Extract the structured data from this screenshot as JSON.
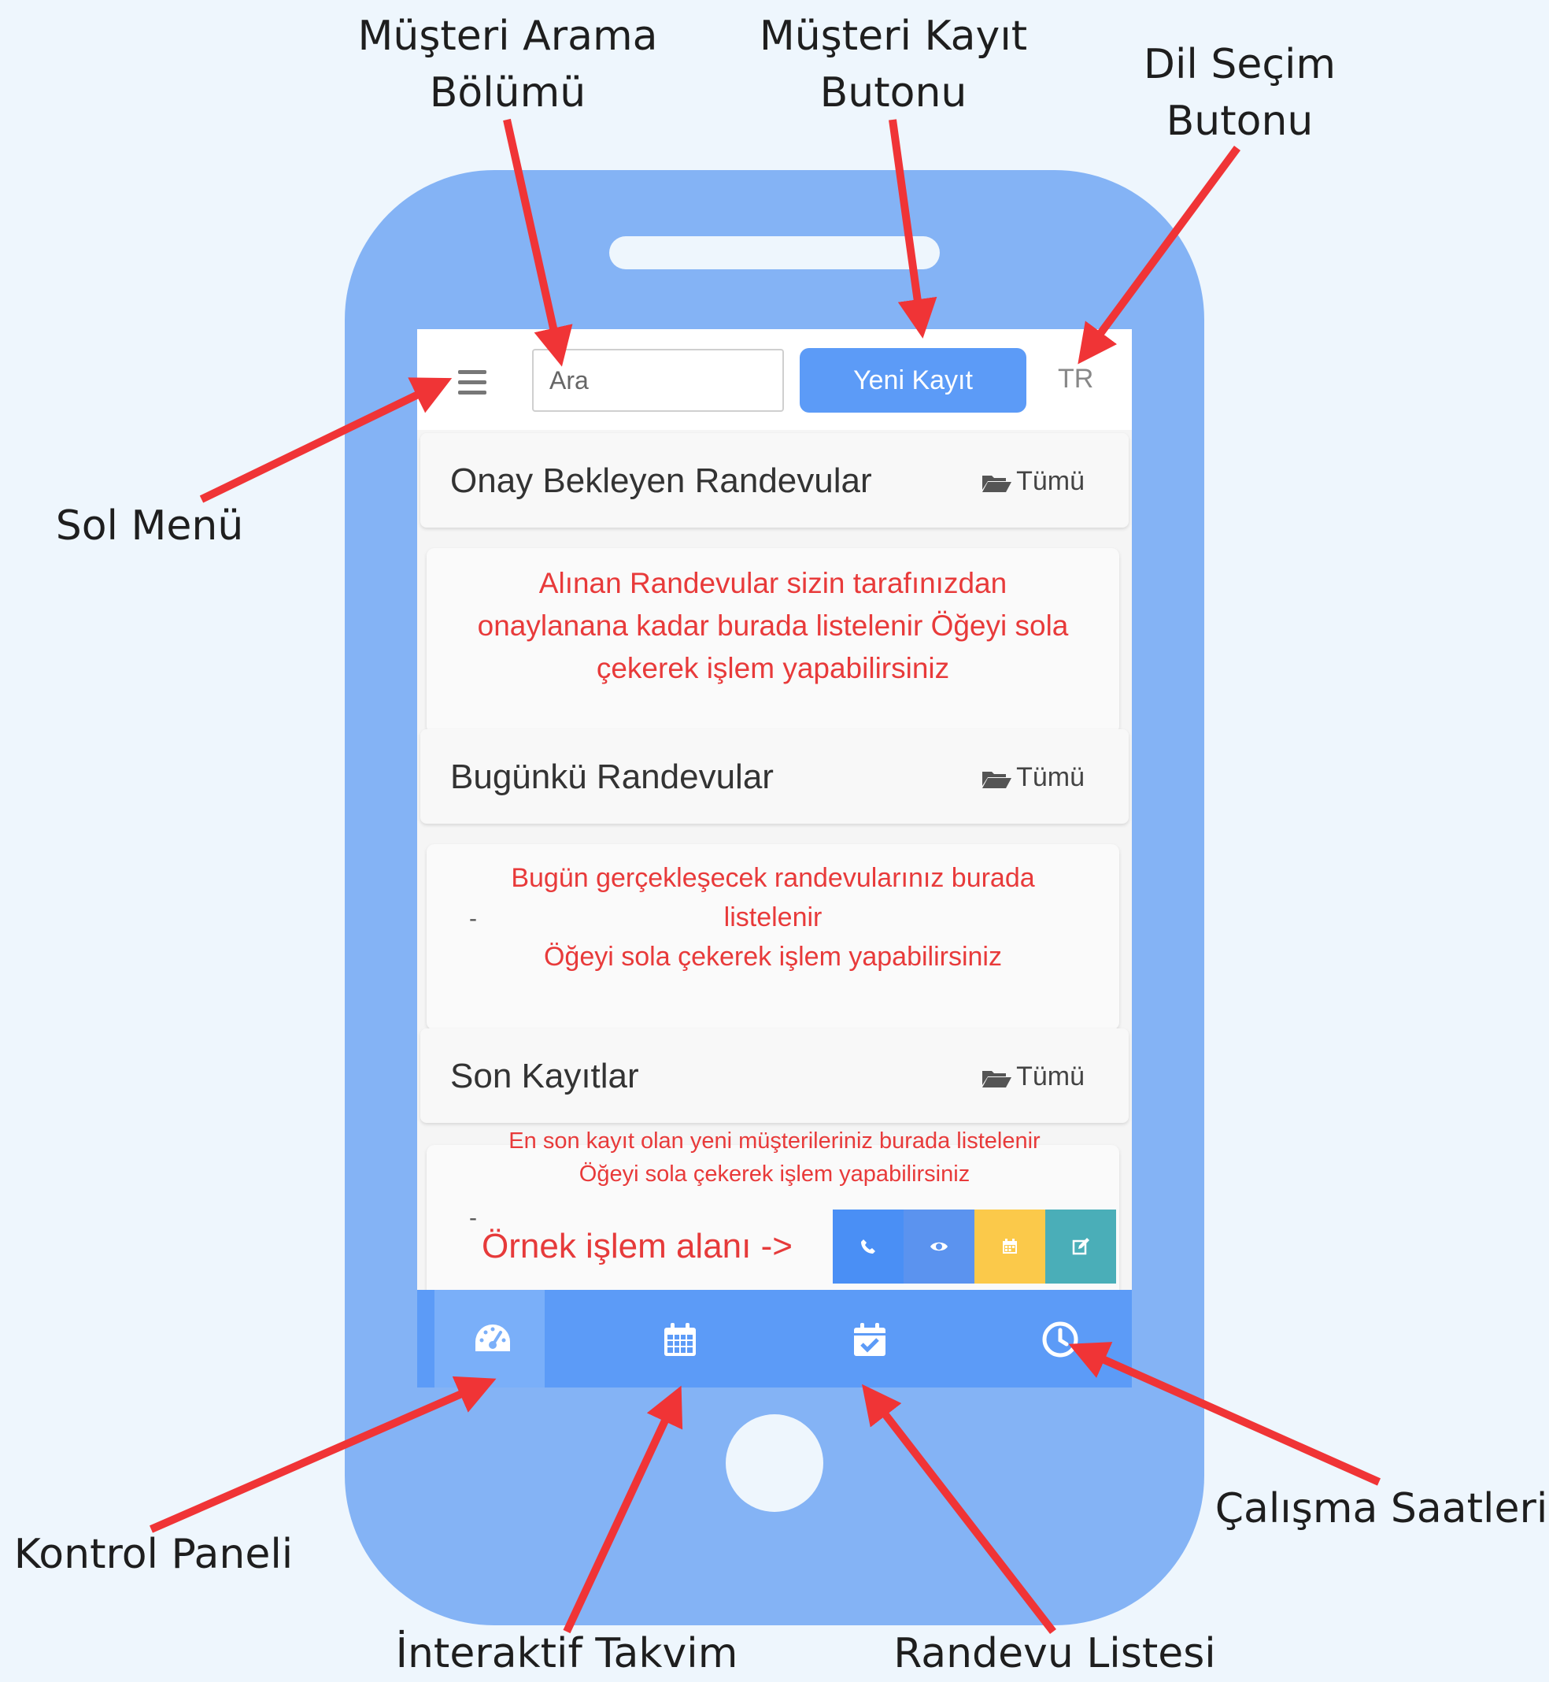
{
  "callouts": {
    "musteri_arama": [
      "Müşteri Arama",
      "Bölümü"
    ],
    "musteri_kayit": [
      "Müşteri Kayıt",
      "Butonu"
    ],
    "dil_secim": [
      "Dil Seçim",
      "Butonu"
    ],
    "sol_menu": "Sol Menü",
    "kontrol_paneli": "Kontrol Paneli",
    "interaktif_takvim": "İnteraktif Takvim",
    "randevu_listesi": "Randevu Listesi",
    "calisma_saatleri": "Çalışma Saatleri"
  },
  "topbar": {
    "search_placeholder": "Ara",
    "new_record_label": "Yeni Kayıt",
    "language": "TR"
  },
  "sections": [
    {
      "title": "Onay Bekleyen Randevular",
      "all_label": "Tümü",
      "message_lines": [
        "Alınan Randevular sizin tarafınızdan",
        "onaylanana kadar burada listelenir Öğeyi sola",
        "çekerek işlem yapabilirsiniz"
      ]
    },
    {
      "title": "Bugünkü Randevular",
      "all_label": "Tümü",
      "message_lines": [
        "Bugün gerçekleşecek randevularınız burada",
        "listelenir",
        "Öğeyi sola çekerek işlem yapabilirsiniz"
      ]
    },
    {
      "title": "Son Kayıtlar",
      "all_label": "Tümü",
      "message_lines": [
        "En son kayıt olan yeni müşterileriniz burada listelenir",
        "Öğeyi sola çekerek işlem yapabilirsiniz"
      ]
    }
  ],
  "example_label": "Örnek işlem alanı ->",
  "dash": "-",
  "actions": [
    {
      "icon": "phone-icon",
      "color": "#4a8ff5"
    },
    {
      "icon": "eye-icon",
      "color": "#5b93ef"
    },
    {
      "icon": "calendar-icon",
      "color": "#fbc94a"
    },
    {
      "icon": "edit-icon",
      "color": "#4aaeb8"
    }
  ],
  "tabs": [
    {
      "icon": "dashboard-icon",
      "active": true
    },
    {
      "icon": "calendar-icon"
    },
    {
      "icon": "calendar-check-icon"
    },
    {
      "icon": "clock-icon"
    }
  ],
  "colors": {
    "phone": "#84b3f5",
    "primary": "#5c9bf7",
    "message_text": "#e83a3a",
    "arrow": "#f03436",
    "background": "#eef6fd"
  }
}
